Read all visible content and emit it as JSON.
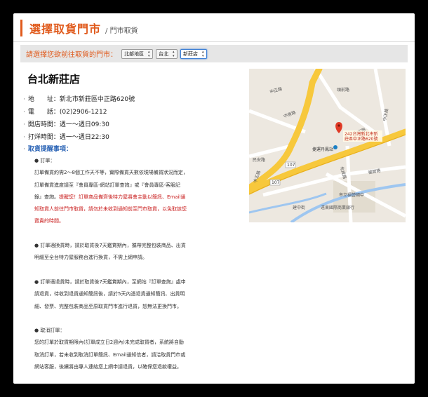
{
  "header": {
    "title": "選擇取貨門市",
    "breadcrumb": "/ 門市取貨"
  },
  "selector": {
    "label": "請選擇您欲前往取貨的門市：",
    "region": "北部地區",
    "city": "台北",
    "store": "新莊店"
  },
  "store": {
    "name": "台北新莊店",
    "rows": [
      {
        "label": "地　　址",
        "value": "新北市新莊區中正路620號"
      },
      {
        "label": "電　　話",
        "value": "(02)2906-1212"
      },
      {
        "label": "開店時間",
        "value": "週一～週日09:30"
      },
      {
        "label": "打烊時間",
        "value": "週一～週日22:30"
      }
    ]
  },
  "notes": {
    "heading": "取貨提醒事項：",
    "order_title": "● 訂單：",
    "order_1": "訂單備貨約需2～8個工作天不等，實際備貨天數依現場備貨狀況而定，",
    "order_2": "訂單備貨進度請至『會員專區-網站訂單查詢』或『會員專區-客服記",
    "order_3a": "錄』查詢。",
    "order_3b": "提醒您！訂單商品備齊後特力屋將會主動以簡訊、Email通",
    "order_4": "知取貨人前往門市取貨，請勿於未收到通知前至門市取貨，以免取該您",
    "order_5": "寶貴的時間。",
    "exchange_1": "● 訂單適換貨時，請於取貨後7天鑑賞期內，攜帶完整包裝商品、出貨",
    "exchange_2": "明細至全台特力屋服務台進行換貨，不需上網申請。",
    "return_1": "● 訂單適退貨時，請於取貨後7天鑑賞期內，至網站『訂單查詢』處申",
    "return_2": "請退貨，待收到退貨通知簡訊後，請於5天內憑退貨通知簡訊、出貨明",
    "return_3": "細、發票、完整包裝商品至原取貨門市進行退貨，恕無法更換門市。",
    "cancel_title": "● 取消訂單：",
    "cancel_1": "您的訂單於取貨期限內(訂單成立日2週內)未完成取貨者，系統將自動",
    "cancel_2": "取消訂單，若未收到取消訂單簡訊、Email通知信者，請洽取貨門市或",
    "cancel_3": "網站客服，後續將由專人連絡您上網申請退貨，以確保您退款權益。"
  },
  "map": {
    "pin_label_1": "242台灣新北市新",
    "pin_label_2": "莊區中正路620號",
    "road_1": "中正路",
    "road_2": "中正路",
    "road_3": "中正路",
    "road_4": "中正路",
    "road_5": "頭前路",
    "road_6": "中原路",
    "road_7": "化成路",
    "road_8": "福營路",
    "road_9": "建中街",
    "road_10": "民安路",
    "road_11": "107",
    "road_12": "107",
    "station": "捷運丹鳳站",
    "company": "遠東國際商業銀行",
    "school": "市立福營國中",
    "colors": {
      "main_road": "#f7c83c",
      "road": "#ffffff",
      "river": "#9ec6f0",
      "pin": "#e03a26"
    }
  }
}
